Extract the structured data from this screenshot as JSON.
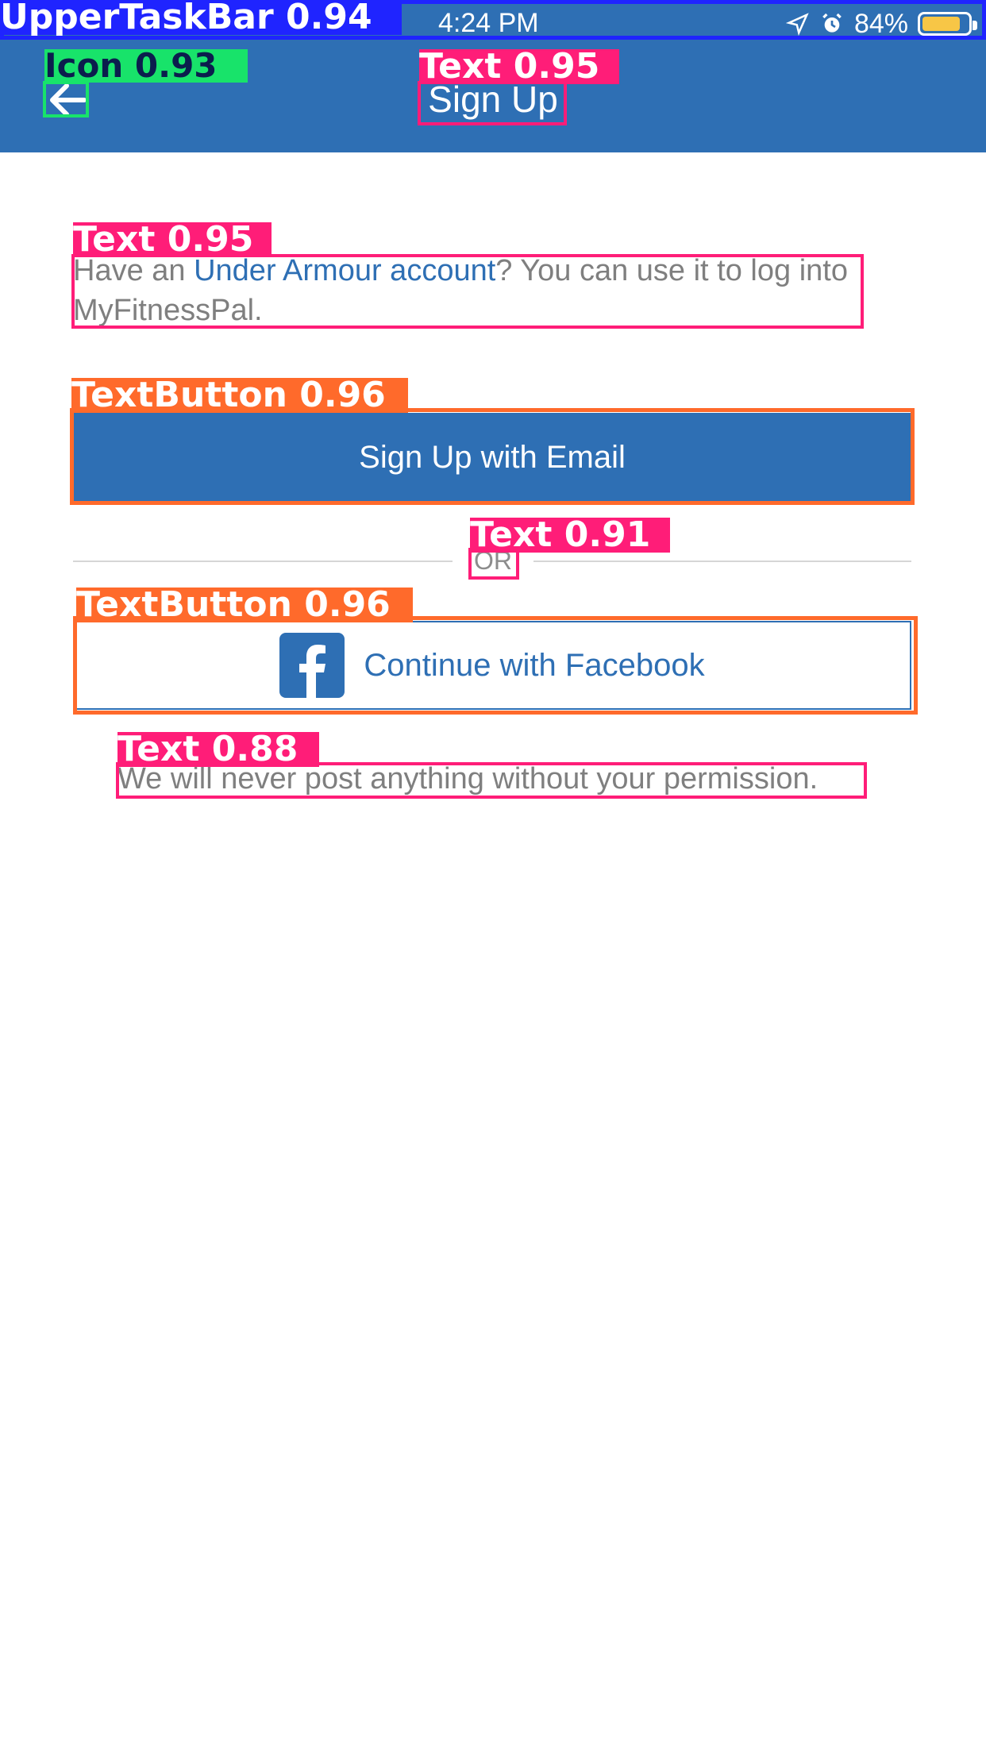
{
  "status_bar": {
    "time": "4:24 PM",
    "battery_percent": "84%",
    "battery_level": 0.84,
    "icons": [
      "location-arrow-icon",
      "alarm-icon",
      "battery-icon"
    ]
  },
  "nav": {
    "back_icon": "back-arrow-icon",
    "title": "Sign Up"
  },
  "intro": {
    "prefix": "Have an ",
    "link": "Under Armour account",
    "suffix": "? You can use it to log into MyFitnessPal."
  },
  "buttons": {
    "email": "Sign Up with Email",
    "facebook": "Continue with Facebook",
    "facebook_icon": "facebook-icon"
  },
  "divider": {
    "or_text": "OR"
  },
  "note": {
    "text": "We will never post anything without your permission."
  },
  "annotations": [
    {
      "label": "UpperTaskBar",
      "score": "0.94",
      "color": "#1f24ff"
    },
    {
      "label": "Icon",
      "score": "0.93",
      "color": "#18e36a"
    },
    {
      "label": "Text",
      "score": "0.95",
      "color": "#ff1d78"
    },
    {
      "label": "Text",
      "score": "0.95",
      "color": "#ff1d78"
    },
    {
      "label": "TextButton",
      "score": "0.96",
      "color": "#ff6a2b"
    },
    {
      "label": "Text",
      "score": "0.91",
      "color": "#ff1d78"
    },
    {
      "label": "TextButton",
      "score": "0.96",
      "color": "#ff6a2b"
    },
    {
      "label": "Text",
      "score": "0.88",
      "color": "#ff1d78"
    }
  ],
  "colors": {
    "brand_blue": "#2e6fb4",
    "text_gray": "#7f7f7f",
    "battery_yellow": "#f7c646"
  }
}
